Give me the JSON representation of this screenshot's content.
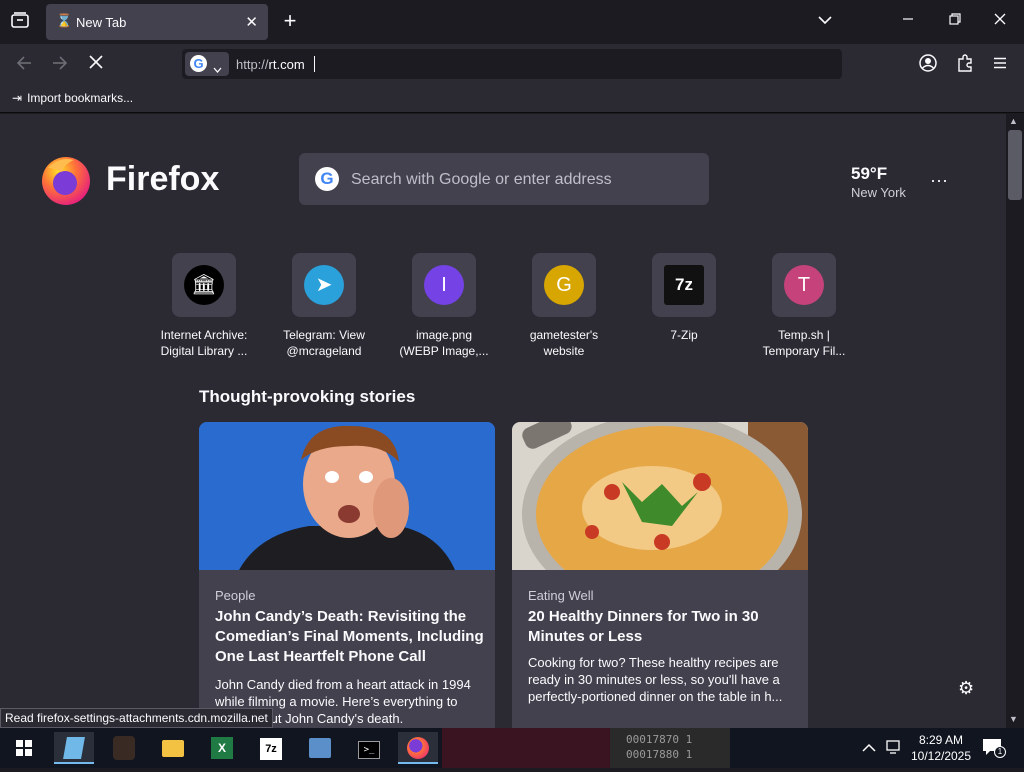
{
  "browser": {
    "tab_title": "New Tab",
    "url_protocol": "http://",
    "url_host": "rt.com",
    "bookmark_import_label": "Import bookmarks...",
    "status_text": "Read firefox-settings-attachments.cdn.mozilla.net"
  },
  "newtab": {
    "logo_text": "Firefox",
    "search_placeholder": "Search with Google or enter address",
    "weather": {
      "temp": "59°F",
      "city": "New York"
    },
    "top_sites": [
      {
        "line1": "Internet Archive:",
        "line2": "Digital Library ...",
        "icon": "internet-archive-icon",
        "glyph": "🏛",
        "color": "#000000"
      },
      {
        "line1": "Telegram: View",
        "line2": "@mcrageland",
        "icon": "telegram-icon",
        "glyph": "➤",
        "color": "#2aa1da"
      },
      {
        "line1": "image.png",
        "line2": "(WEBP Image,...",
        "icon": "letter-i-icon",
        "glyph": "I",
        "color": "#7542e5"
      },
      {
        "line1": "gametester's",
        "line2": "website",
        "icon": "letter-g-icon",
        "glyph": "G",
        "color": "#d7a600"
      },
      {
        "line1": "7-Zip",
        "line2": "",
        "icon": "7zip-icon",
        "glyph": "7z",
        "color": "#111111"
      },
      {
        "line1": "Temp.sh |",
        "line2": "Temporary Fil...",
        "icon": "letter-t-icon",
        "glyph": "T",
        "color": "#c5427a"
      }
    ],
    "stories_heading": "Thought-provoking stories",
    "stories": [
      {
        "source": "People",
        "headline": "John Candy’s Death: Revisiting the Comedian’s Final Moments, Including One Last Heartfelt Phone Call",
        "excerpt": "John Candy died from a heart attack in 1994 while filming a movie. Here’s everything to know about John Candy's death."
      },
      {
        "source": "Eating Well",
        "headline": "20 Healthy Dinners for Two in 30 Minutes or Less",
        "excerpt": "Cooking for two? These healthy recipes are ready in 30 minutes or less, so you'll have a perfectly-portioned dinner on the table in h..."
      }
    ]
  },
  "taskbar": {
    "time": "8:29 AM",
    "date": "10/12/2025",
    "notification_count": "1",
    "bg_text_1": "00017870  1",
    "bg_text_2": "00017880  1"
  }
}
